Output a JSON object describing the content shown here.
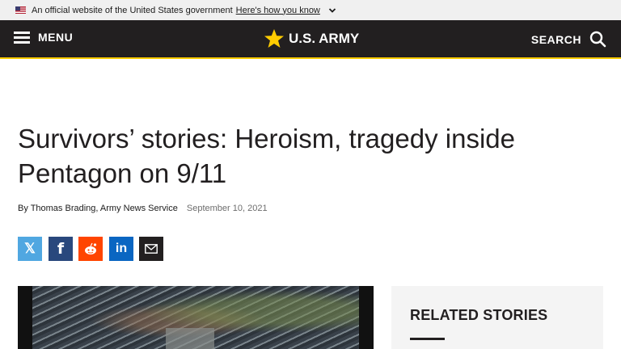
{
  "gov_banner": {
    "text": "An official website of the United States government",
    "link": "Here's how you know"
  },
  "header": {
    "menu_label": "MENU",
    "logo_text": "U.S. ARMY",
    "search_label": "SEARCH",
    "background_color": "#221f20",
    "accent_color": "#ffcc01"
  },
  "article": {
    "title": "Survivors’ stories: Heroism, tragedy inside Pentagon on 9/11",
    "byline": "By Thomas Brading, Army News Service",
    "date": "September 10, 2021"
  },
  "share": {
    "x": "𝕏",
    "facebook": "f",
    "linkedin": "in"
  },
  "related": {
    "title": "RELATED STORIES"
  }
}
